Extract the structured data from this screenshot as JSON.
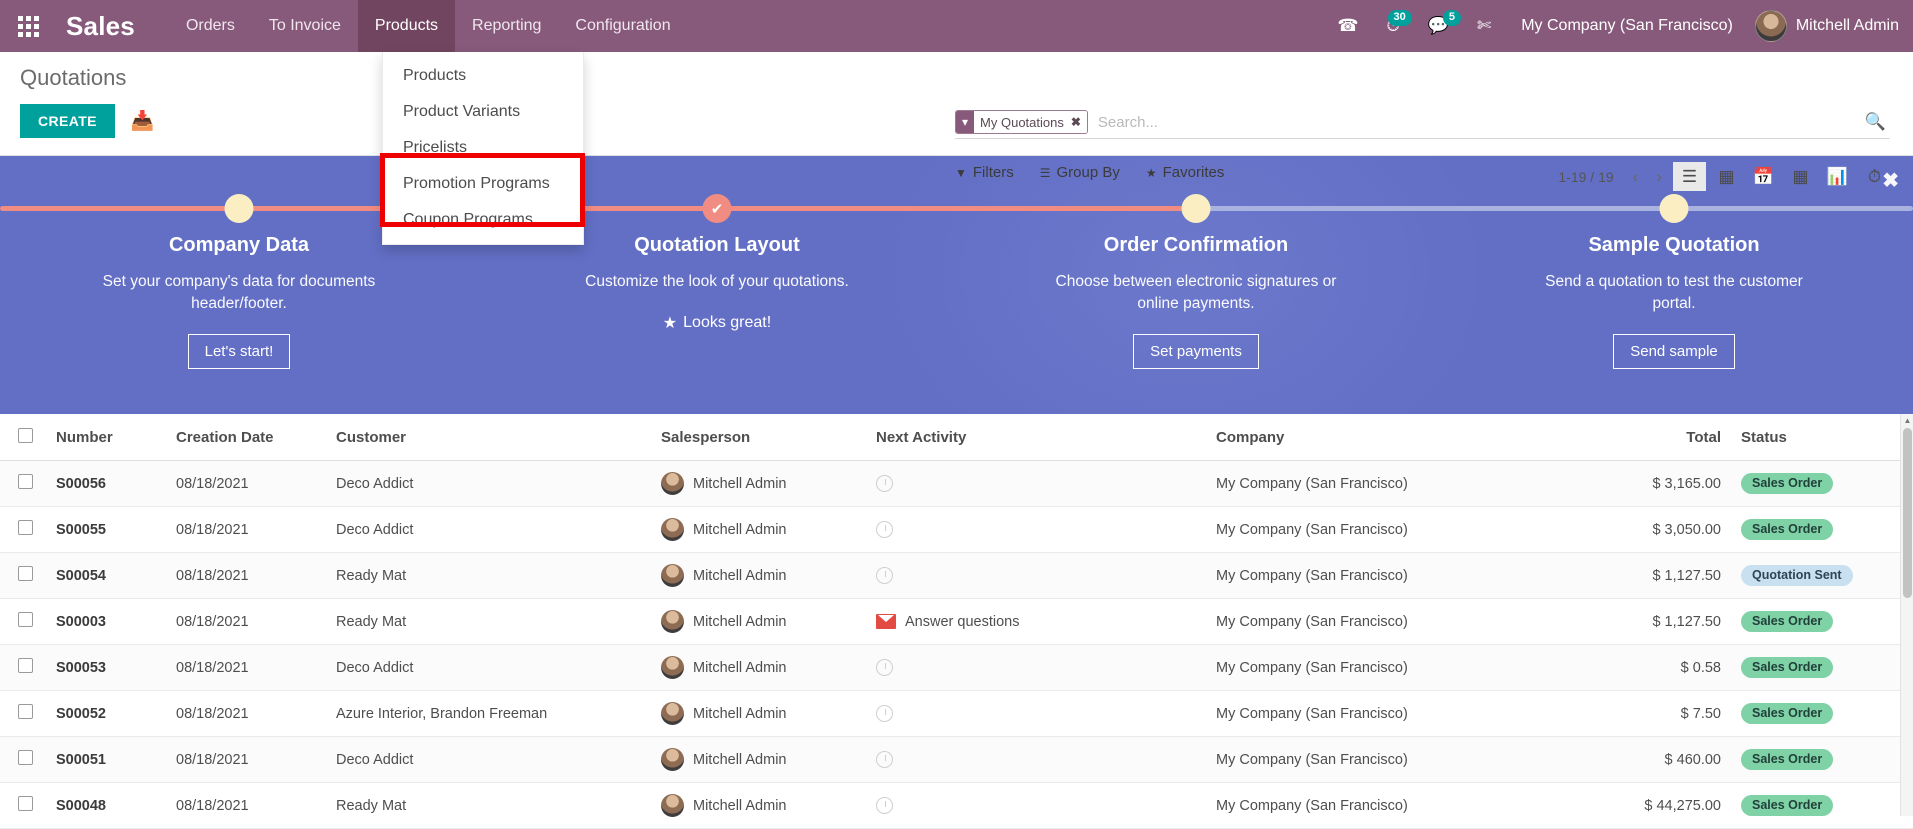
{
  "navbar": {
    "apps_icon": "apps-grid-icon",
    "brand": "Sales",
    "menus": [
      {
        "label": "Orders",
        "active": false
      },
      {
        "label": "To Invoice",
        "active": false
      },
      {
        "label": "Products",
        "active": true
      },
      {
        "label": "Reporting",
        "active": false
      },
      {
        "label": "Configuration",
        "active": false
      }
    ],
    "phone_icon": "phone-icon",
    "activity_icon": "clock-activity-icon",
    "activity_count": "30",
    "messages_icon": "chat-bubble-icon",
    "messages_count": "5",
    "tools_icon": "wrench-icon",
    "company": "My Company (San Francisco)",
    "user": "Mitchell Admin"
  },
  "dropdown": {
    "items": [
      "Products",
      "Product Variants",
      "Pricelists",
      "Promotion Programs",
      "Coupon Programs"
    ],
    "highlight_color": "#ee0000"
  },
  "control_panel": {
    "title": "Quotations",
    "create_label": "CREATE",
    "import_icon": "import-download-icon",
    "search": {
      "facet_icon": "filter-funnel-icon",
      "facet_label": "My Quotations",
      "facet_remove_icon": "close-x-icon",
      "placeholder": "Search...",
      "value": "",
      "search_icon": "magnifier-icon"
    },
    "filters": [
      {
        "icon": "filter-funnel-icon",
        "label": "Filters"
      },
      {
        "icon": "hamburger-lines-icon",
        "label": "Group By"
      },
      {
        "icon": "star-icon",
        "label": "Favorites"
      }
    ],
    "pager": {
      "range": "1-19 / 19",
      "prev_icon": "chevron-left-icon",
      "next_icon": "chevron-right-icon"
    },
    "views": [
      {
        "icon": "list-view-icon",
        "active": true
      },
      {
        "icon": "kanban-view-icon",
        "active": false
      },
      {
        "icon": "calendar-view-icon",
        "active": false
      },
      {
        "icon": "pivot-view-icon",
        "active": false
      },
      {
        "icon": "graph-view-icon",
        "active": false
      },
      {
        "icon": "activity-view-icon",
        "active": false
      }
    ]
  },
  "banner": {
    "close_icon": "close-x-icon",
    "accent_done": "#f08c82",
    "accent_todo": "#aab2e0",
    "steps": [
      {
        "title": "Company Data",
        "desc": "Set your company's data for documents header/footer.",
        "state": "pending",
        "action_label": "Let's start!",
        "action_type": "button"
      },
      {
        "title": "Quotation Layout",
        "desc": "Customize the look of your quotations.",
        "state": "done",
        "action_label": "Looks great!",
        "action_type": "done",
        "done_icon": "star-icon"
      },
      {
        "title": "Order Confirmation",
        "desc": "Choose between electronic signatures or online payments.",
        "state": "pending",
        "action_label": "Set payments",
        "action_type": "button"
      },
      {
        "title": "Sample Quotation",
        "desc": "Send a quotation to test the customer portal.",
        "state": "pending",
        "action_label": "Send sample",
        "action_type": "button"
      }
    ]
  },
  "table": {
    "columns": [
      "Number",
      "Creation Date",
      "Customer",
      "Salesperson",
      "Next Activity",
      "Company",
      "Total",
      "Status"
    ],
    "options_icon": "kebab-menu-icon",
    "rows": [
      {
        "number": "S00056",
        "date": "08/18/2021",
        "customer": "Deco Addict",
        "salesperson": "Mitchell Admin",
        "activity": "",
        "activity_icon": "clock-icon",
        "company": "My Company (San Francisco)",
        "total": "$ 3,165.00",
        "status": "Sales Order",
        "status_kind": "sales"
      },
      {
        "number": "S00055",
        "date": "08/18/2021",
        "customer": "Deco Addict",
        "salesperson": "Mitchell Admin",
        "activity": "",
        "activity_icon": "clock-icon",
        "company": "My Company (San Francisco)",
        "total": "$ 3,050.00",
        "status": "Sales Order",
        "status_kind": "sales"
      },
      {
        "number": "S00054",
        "date": "08/18/2021",
        "customer": "Ready Mat",
        "salesperson": "Mitchell Admin",
        "activity": "",
        "activity_icon": "clock-icon",
        "company": "My Company (San Francisco)",
        "total": "$ 1,127.50",
        "status": "Quotation Sent",
        "status_kind": "quote"
      },
      {
        "number": "S00003",
        "date": "08/18/2021",
        "customer": "Ready Mat",
        "salesperson": "Mitchell Admin",
        "activity": "Answer questions",
        "activity_icon": "mail-icon",
        "company": "My Company (San Francisco)",
        "total": "$ 1,127.50",
        "status": "Sales Order",
        "status_kind": "sales"
      },
      {
        "number": "S00053",
        "date": "08/18/2021",
        "customer": "Deco Addict",
        "salesperson": "Mitchell Admin",
        "activity": "",
        "activity_icon": "clock-icon",
        "company": "My Company (San Francisco)",
        "total": "$ 0.58",
        "status": "Sales Order",
        "status_kind": "sales"
      },
      {
        "number": "S00052",
        "date": "08/18/2021",
        "customer": "Azure Interior, Brandon Freeman",
        "salesperson": "Mitchell Admin",
        "activity": "",
        "activity_icon": "clock-icon",
        "company": "My Company (San Francisco)",
        "total": "$ 7.50",
        "status": "Sales Order",
        "status_kind": "sales"
      },
      {
        "number": "S00051",
        "date": "08/18/2021",
        "customer": "Deco Addict",
        "salesperson": "Mitchell Admin",
        "activity": "",
        "activity_icon": "clock-icon",
        "company": "My Company (San Francisco)",
        "total": "$ 460.00",
        "status": "Sales Order",
        "status_kind": "sales"
      },
      {
        "number": "S00048",
        "date": "08/18/2021",
        "customer": "Ready Mat",
        "salesperson": "Mitchell Admin",
        "activity": "",
        "activity_icon": "clock-icon",
        "company": "My Company (San Francisco)",
        "total": "$ 44,275.00",
        "status": "Sales Order",
        "status_kind": "sales"
      }
    ]
  }
}
